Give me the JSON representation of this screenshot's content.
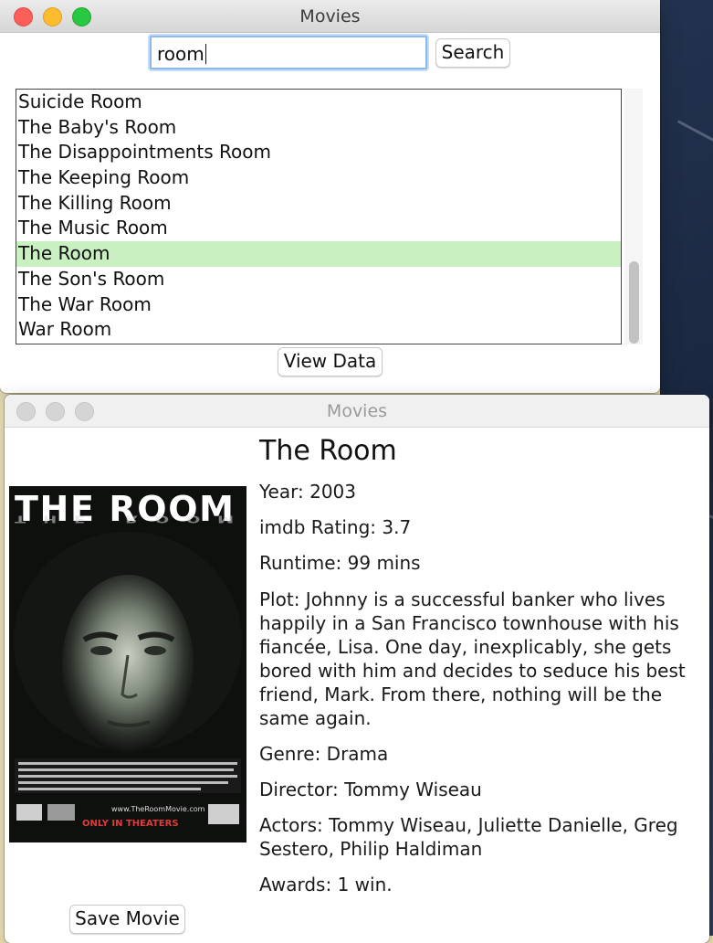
{
  "search_window": {
    "title": "Movies",
    "search_value": "room",
    "search_button": "Search",
    "results": [
      "Suicide Room",
      "The Baby's Room",
      "The Disappointments Room",
      "The Keeping Room",
      "The Killing Room",
      "The Music Room",
      "The Room",
      "The Son's Room",
      "The War Room",
      "War Room"
    ],
    "selected_result": "The Room",
    "view_button": "View Data"
  },
  "detail_window": {
    "title": "Movies",
    "movie_title": "The Room",
    "poster": {
      "headline": "THE ROOM",
      "tagline": "ONLY IN THEATERS",
      "site": "www.TheRoomMovie.com"
    },
    "year": "Year: 2003",
    "rating": "imdb Rating: 3.7",
    "runtime": "Runtime: 99 mins",
    "plot": "Plot: Johnny is a successful banker who lives happily in a San Francisco townhouse with his fiancée, Lisa. One day, inexplicably, she gets bored with him and decides to seduce his best friend, Mark. From there, nothing will be the same again.",
    "genre": "Genre: Drama",
    "director": "Director: Tommy Wiseau",
    "actors": "Actors: Tommy Wiseau, Juliette Danielle, Greg Sestero, Philip Haldiman",
    "awards": "Awards: 1 win.",
    "save_button": "Save Movie"
  },
  "colors": {
    "selection": "#c8f0c0",
    "focus_ring": "#8db9ea",
    "close": "#fc5f57",
    "minimize": "#fdbc2e",
    "zoom": "#28c840"
  }
}
